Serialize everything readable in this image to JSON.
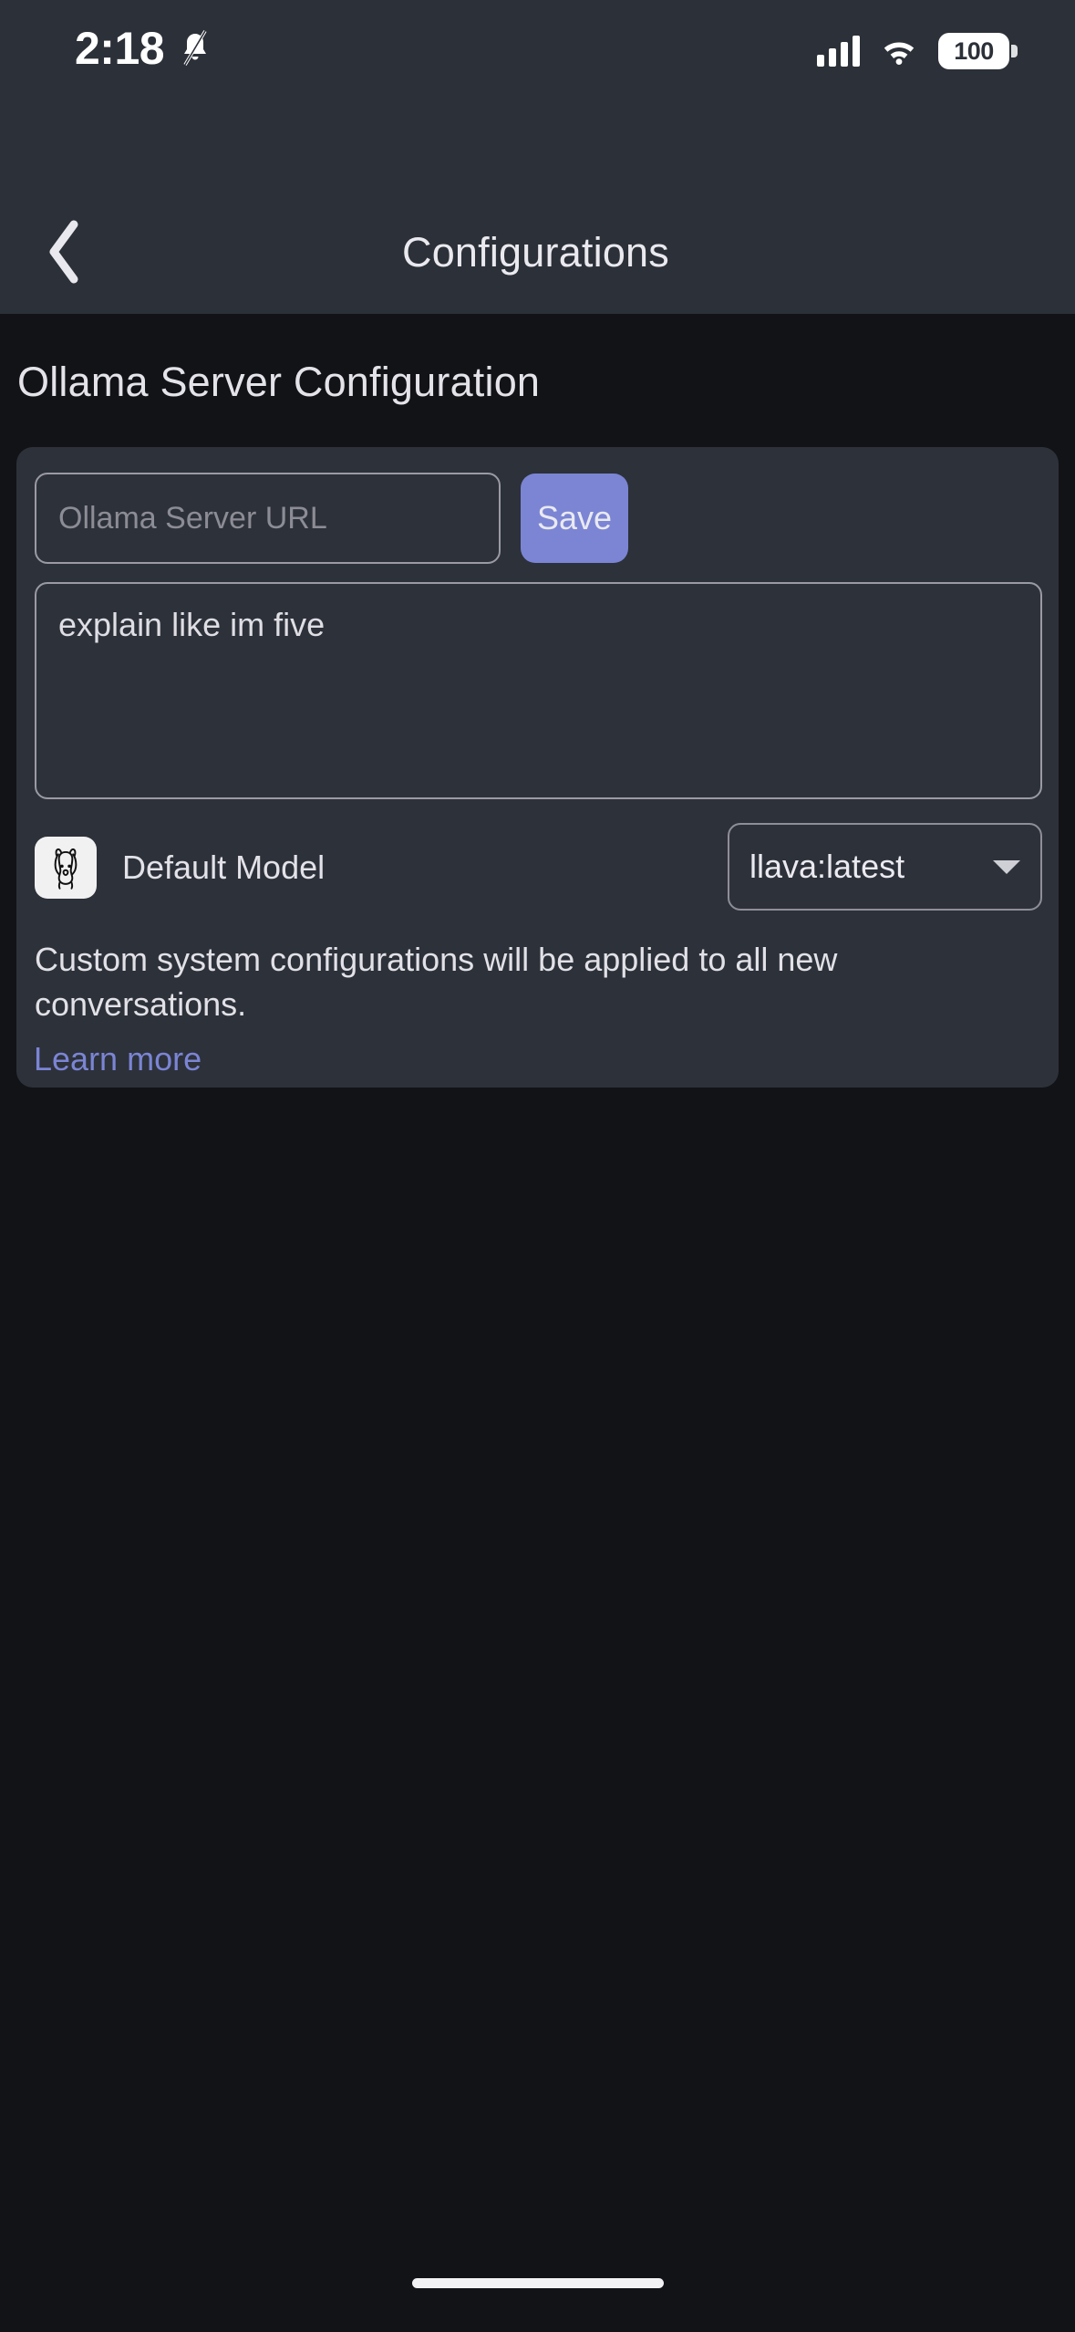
{
  "status_bar": {
    "time": "2:18",
    "notifications_icon": "bell-muted-icon",
    "signal_icon": "cellular-signal-icon",
    "wifi_icon": "wifi-icon",
    "battery_level": "100"
  },
  "nav": {
    "back_icon": "chevron-left-icon",
    "title": "Configurations"
  },
  "page": {
    "section_title": "Ollama Server Configuration"
  },
  "server": {
    "url_value": "",
    "url_placeholder": "Ollama Server URL",
    "save_label": "Save"
  },
  "system_prompt": {
    "value": "explain like im five",
    "placeholder": ""
  },
  "default_model": {
    "icon": "llama-avatar-icon",
    "label": "Default Model",
    "selected": "llava:latest",
    "caret_icon": "chevron-down-icon"
  },
  "footer": {
    "help_text": "Custom system configurations will be applied to all new conversations.",
    "learn_more_label": "Learn more"
  },
  "colors": {
    "status_bar_bg": "#2c3038",
    "page_bg": "#121317",
    "card_bg": "#2d313a",
    "accent": "#7b85d4",
    "text_primary": "#e3e3e9",
    "text_placeholder": "#8c8c95"
  }
}
